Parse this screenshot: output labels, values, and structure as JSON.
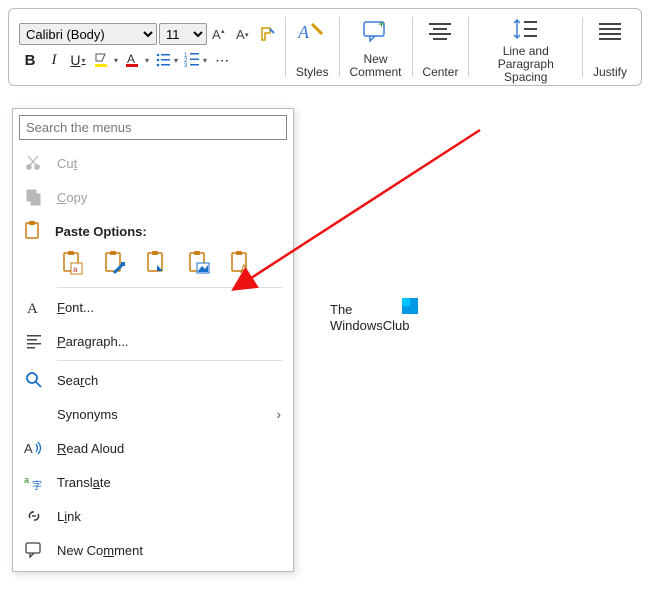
{
  "ribbon": {
    "font_name": "Calibri (Body)",
    "font_size": "11",
    "styles_label": "Styles",
    "new_comment_label": "New\nComment",
    "center_label": "Center",
    "spacing_label": "Line and\nParagraph Spacing",
    "justify_label": "Justify"
  },
  "context": {
    "search_placeholder": "Search the menus",
    "cut": "Cut",
    "copy": "Copy",
    "paste_header": "Paste Options:",
    "font": "Font...",
    "paragraph": "Paragraph...",
    "search": "Search",
    "synonyms": "Synonyms",
    "read_aloud": "Read Aloud",
    "translate": "Translate",
    "link": "Link",
    "new_comment": "New Comment"
  },
  "watermark": {
    "line1": "The",
    "line2": "WindowsClub"
  }
}
